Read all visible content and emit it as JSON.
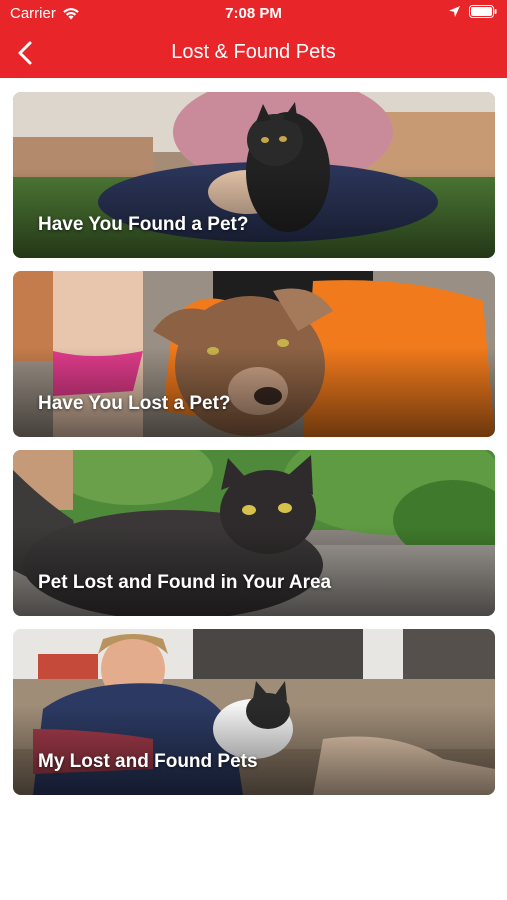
{
  "status_bar": {
    "carrier": "Carrier",
    "time": "7:08 PM",
    "icons": [
      "wifi-icon",
      "location-arrow-icon",
      "battery-icon"
    ]
  },
  "nav": {
    "title": "Lost & Found Pets",
    "back_icon": "chevron-left-icon"
  },
  "colors": {
    "header": "#e8262a",
    "text_on_header": "#ffffff",
    "background": "#ffffff"
  },
  "cards": [
    {
      "label": "Have You Found a Pet?",
      "image": "person holding black long-haired cat on lawn"
    },
    {
      "label": "Have You Lost a Pet?",
      "image": "child in orange hoodie hugging brown dog"
    },
    {
      "label": "Pet Lost and Found in Your Area",
      "image": "dark grey fluffy cat in front of green plants"
    },
    {
      "label": "My Lost and Found Pets",
      "image": "smiling man on sofa holding black and white cat"
    }
  ]
}
